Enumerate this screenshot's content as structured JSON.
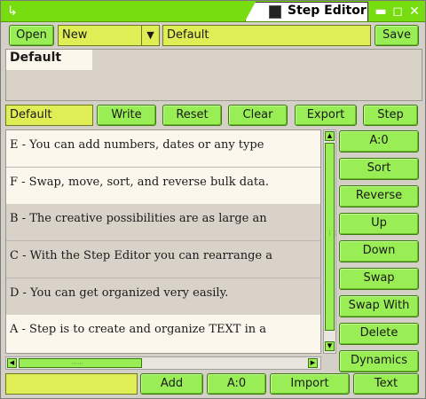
{
  "window": {
    "title": "Step Editor",
    "menu_glyph": "↳",
    "controls": {
      "minimize": "▬",
      "maximize": "◻",
      "close": "✕"
    }
  },
  "toolbar": {
    "open_label": "Open",
    "mode_value": "New",
    "dropdown_glyph": "▼",
    "name_value": "Default",
    "save_label": "Save"
  },
  "top_panel": {
    "label": "Default"
  },
  "action_bar": {
    "field_value": "Default",
    "write_label": "Write",
    "reset_label": "Reset",
    "clear_label": "Clear",
    "export_label": "Export",
    "step_label": "Step"
  },
  "list": {
    "items": [
      {
        "text": "E - You can add numbers, dates or any type",
        "shaded": false
      },
      {
        "text": "F -  Swap, move, sort, and reverse bulk data.",
        "shaded": false
      },
      {
        "text": "B - The creative possibilities are as large an",
        "shaded": true
      },
      {
        "text": "C - With the Step Editor you can rearrange a",
        "shaded": true
      },
      {
        "text": "D - You can get organized very easily.",
        "shaded": true
      },
      {
        "text": "A - Step is to create and organize TEXT in a",
        "shaded": false
      }
    ]
  },
  "side_buttons": {
    "counter": "A:0",
    "sort": "Sort",
    "reverse": "Reverse",
    "up": "Up",
    "down": "Down",
    "swap": "Swap",
    "swap_with": "Swap With",
    "delete": "Delete",
    "dynamics": "Dynamics"
  },
  "bottom_bar": {
    "field_value": "",
    "add_label": "Add",
    "counter": "A:0",
    "import_label": "Import",
    "text_label": "Text"
  },
  "colors": {
    "accent": "#77dd11",
    "button": "#99ee55",
    "field": "#e0ee55",
    "list_bg": "#fbf7ec",
    "list_shaded": "#d8d2c8"
  }
}
